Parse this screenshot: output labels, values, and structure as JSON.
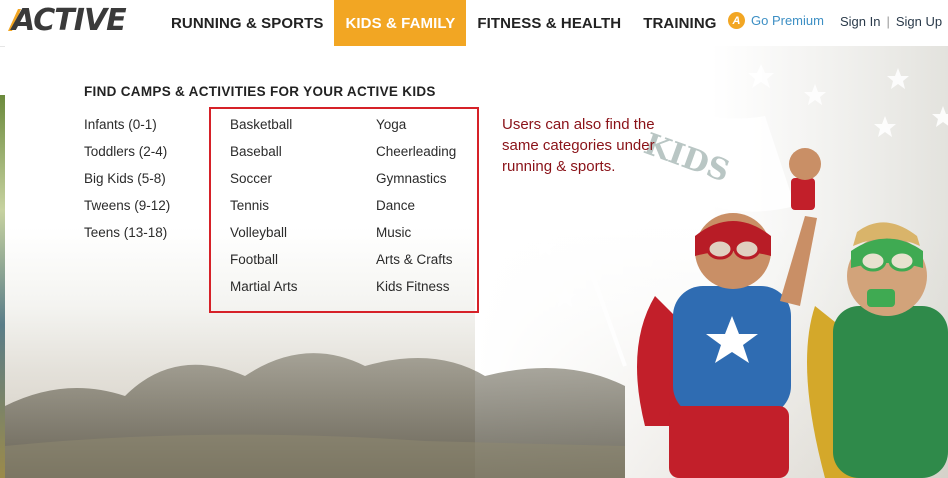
{
  "header": {
    "logo_text": "ACTIVE",
    "nav": [
      "RUNNING & SPORTS",
      "KIDS & FAMILY",
      "FITNESS & HEALTH",
      "TRAINING"
    ],
    "active_nav_index": 1,
    "premium_label": "Go Premium",
    "sign_in": "Sign In",
    "separator": "|",
    "sign_up": "Sign Up"
  },
  "dropdown": {
    "heading": "FIND CAMPS & ACTIVITIES FOR YOUR ACTIVE KIDS",
    "age_groups": [
      "Infants (0-1)",
      "Toddlers (2-4)",
      "Big Kids (5-8)",
      "Tweens (9-12)",
      "Teens (13-18)"
    ],
    "categories_col1": [
      "Basketball",
      "Baseball",
      "Soccer",
      "Tennis",
      "Volleyball",
      "Football",
      "Martial Arts"
    ],
    "categories_col2": [
      "Yoga",
      "Cheerleading",
      "Gymnastics",
      "Dance",
      "Music",
      "Arts & Crafts",
      "Kids Fitness"
    ]
  },
  "annotation": {
    "text": "Users can also find the same categories under running & sports."
  },
  "hero": {
    "flag_text": "KIDS"
  },
  "colors": {
    "accent": "#f2a623",
    "link": "#3d8fc4",
    "highlight_box": "#d62128",
    "annotation_text": "#8a1218"
  }
}
